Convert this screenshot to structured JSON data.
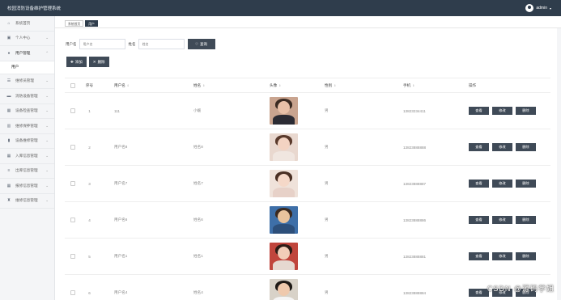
{
  "app": {
    "title": "校园消防设备维护管理系统",
    "user": "admin"
  },
  "sidebar": {
    "items": [
      {
        "label": "系统首页",
        "icon": "home-icon",
        "chevron": false
      },
      {
        "label": "个人中心",
        "icon": "calendar-icon",
        "chevron": true
      },
      {
        "label": "用户管理",
        "icon": "user-icon",
        "chevron": true,
        "active": true
      },
      {
        "label": "维修员管理",
        "icon": "list-icon",
        "chevron": true
      },
      {
        "label": "消防设备管理",
        "icon": "monitor-icon",
        "chevron": true
      },
      {
        "label": "设备检查管理",
        "icon": "grid-icon",
        "chevron": true
      },
      {
        "label": "维修保养管理",
        "icon": "chart-icon",
        "chevron": true
      },
      {
        "label": "设备维修管理",
        "icon": "bar-chart-icon",
        "chevron": true
      },
      {
        "label": "入库信息管理",
        "icon": "grid-icon",
        "chevron": true
      },
      {
        "label": "出库信息管理",
        "icon": "sliders-icon",
        "chevron": true
      },
      {
        "label": "报修信息管理",
        "icon": "grid-icon",
        "chevron": true
      },
      {
        "label": "维修信息管理",
        "icon": "trophy-icon",
        "chevron": true
      }
    ],
    "sub_item": "用户"
  },
  "tabs": [
    {
      "label": "系统首页",
      "active": false
    },
    {
      "label": "用户",
      "active": true
    }
  ],
  "search": {
    "username_label": "用户名",
    "username_placeholder": "用户名",
    "name_label": "姓名",
    "name_placeholder": "姓名",
    "button": "查询"
  },
  "actions": {
    "add": "添加",
    "delete": "删除"
  },
  "table": {
    "headers": {
      "index": "序号",
      "username": "用户名",
      "name": "姓名",
      "photo": "头像",
      "gender": "性别",
      "phone": "手机",
      "ops": "操作"
    },
    "rows": [
      {
        "index": "1",
        "username": "111",
        "name": "小媛",
        "gender": "男",
        "phone": "13823234411"
      },
      {
        "index": "2",
        "username": "用户名8",
        "name": "姓名8",
        "gender": "男",
        "phone": "13823888888"
      },
      {
        "index": "3",
        "username": "用户名7",
        "name": "姓名7",
        "gender": "男",
        "phone": "13823888887"
      },
      {
        "index": "4",
        "username": "用户名6",
        "name": "姓名6",
        "gender": "男",
        "phone": "13823888886"
      },
      {
        "index": "5",
        "username": "用户名1",
        "name": "姓名1",
        "gender": "男",
        "phone": "13823888881"
      },
      {
        "index": "6",
        "username": "用户名4",
        "name": "姓名4",
        "gender": "男",
        "phone": "13823888884"
      }
    ],
    "row_buttons": {
      "view": "查看",
      "edit": "修改",
      "delete": "删除"
    }
  },
  "watermark": "CSDN @源码学姐",
  "colors": {
    "topbar": "#2f3d4c",
    "button": "#3f4a57",
    "sidebar": "#f4f5f7"
  }
}
